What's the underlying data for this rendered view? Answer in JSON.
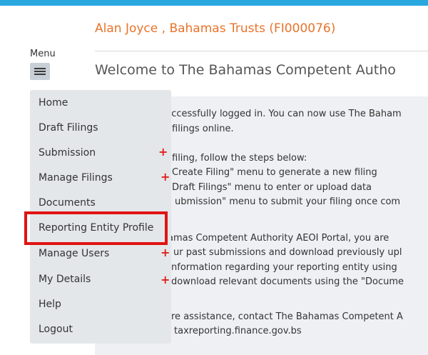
{
  "header": {
    "user_title": "Alan Joyce , Bahamas Trusts (FI000076)",
    "welcome_title": "Welcome to The Bahamas Competent Autho"
  },
  "menu": {
    "label": "Menu",
    "items": [
      {
        "label": "Home",
        "has_submenu": false
      },
      {
        "label": "Draft Filings",
        "has_submenu": false
      },
      {
        "label": "Submission",
        "has_submenu": true
      },
      {
        "label": "Manage Filings",
        "has_submenu": true
      },
      {
        "label": "Documents",
        "has_submenu": false
      },
      {
        "label": "Reporting Entity Profile",
        "has_submenu": false,
        "highlighted": true
      },
      {
        "label": "Manage Users",
        "has_submenu": true
      },
      {
        "label": "My Details",
        "has_submenu": true
      },
      {
        "label": "Help",
        "has_submenu": false
      },
      {
        "label": "Logout",
        "has_submenu": false
      }
    ],
    "submenu_indicator": "+"
  },
  "content": {
    "lines": [
      "uccessfully logged in. You can now use The Baham",
      "filings online.",
      "filing, follow the steps below:",
      "Create Filing\" menu to generate a new filing",
      "Draft Filings\" menu to enter or upload data",
      "ubmission\" menu to submit your filing once com",
      "amas Competent Authority AEOI Portal, you are",
      "ur past submissions and download previously upl",
      "nformation regarding your reporting entity using",
      "download relevant documents using the \"Docume",
      "re assistance, contact The Bahamas Competent A",
      "taxreporting.finance.gov.bs"
    ]
  },
  "colors": {
    "top_bar": "#29a8e0",
    "user_title": "#e8732a",
    "highlight_border": "#e01313",
    "submenu_plus": "#e0201c"
  }
}
